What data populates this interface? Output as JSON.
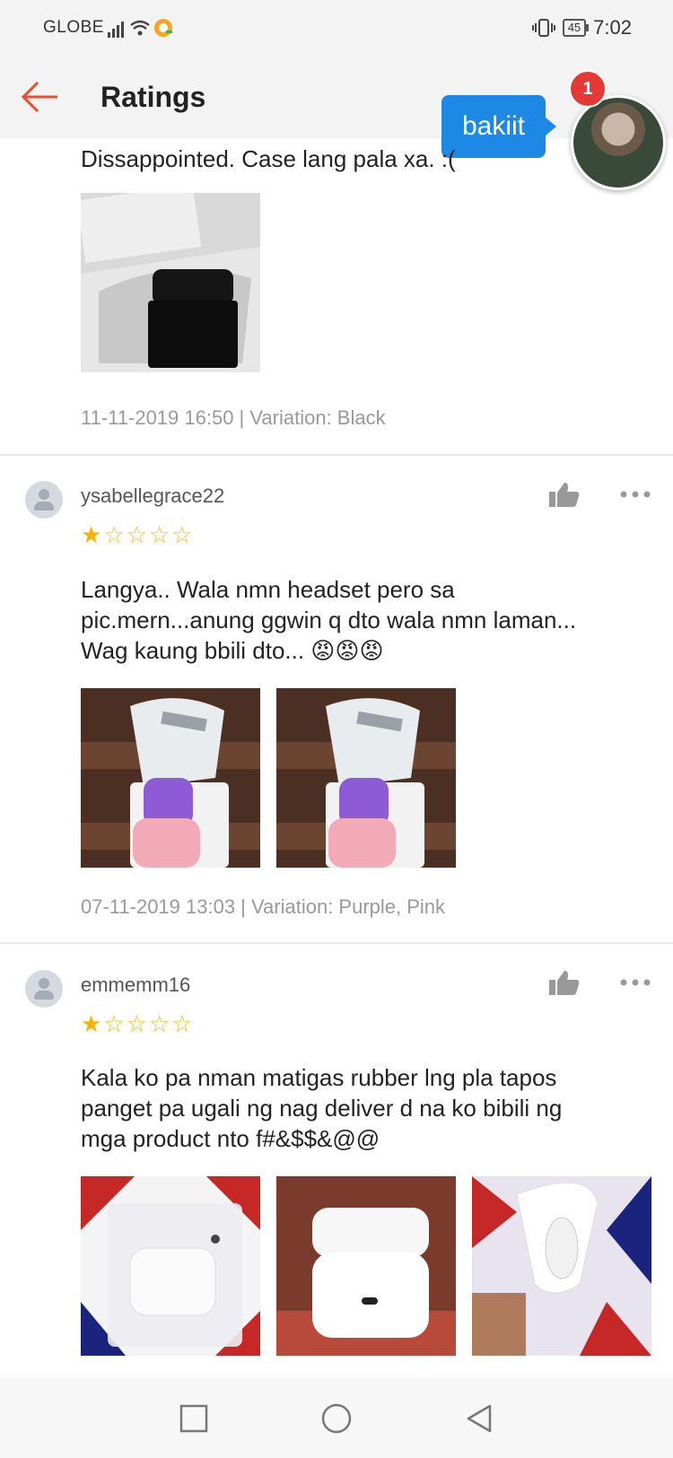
{
  "status_bar": {
    "carrier": "GLOBE",
    "battery": "45",
    "time": "7:02"
  },
  "header": {
    "title": "Ratings"
  },
  "chat_head": {
    "message": "bakiit",
    "badge_count": "1"
  },
  "reviews": [
    {
      "text": "Dissappointed. Case lang pala xa. :(",
      "meta": "11-11-2019 16:50 | Variation: Black"
    },
    {
      "username": "ysabellegrace22",
      "rating": 1,
      "text_lines": [
        "Langya.. Wala nmn headset pero sa",
        "pic.mern...anung ggwin q dto wala nmn laman...",
        "Wag kaung bbili dto... 😡😡😡"
      ],
      "meta": "07-11-2019 13:03 | Variation: Purple, Pink"
    },
    {
      "username": "emmemm16",
      "rating": 1,
      "text_lines": [
        "Kala ko pa nman matigas rubber lng pla tapos",
        "panget pa ugali ng nag deliver d na ko bibili ng",
        "mga product nto f#&$$&@@"
      ]
    }
  ],
  "stars": {
    "filled": "★",
    "empty": "☆"
  },
  "icons": {
    "back": "arrow-left-icon",
    "like": "thumbs-up-icon",
    "more": "more-dots-icon",
    "avatar": "user-avatar-icon",
    "nav_recent": "square-icon",
    "nav_home": "circle-icon",
    "nav_back": "triangle-back-icon"
  },
  "colors": {
    "accent": "#ee4d2d",
    "star": "#f6b400",
    "bubble": "#1e88e5",
    "badge": "#e53935"
  }
}
